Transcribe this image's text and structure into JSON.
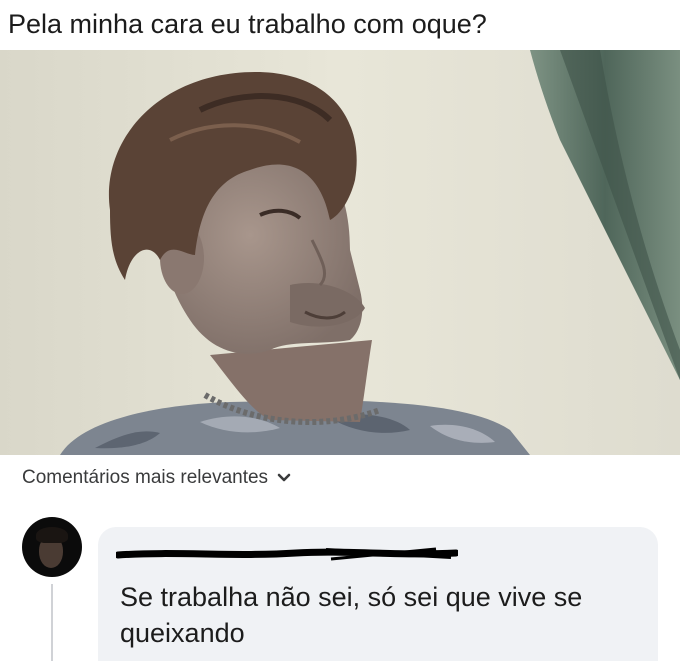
{
  "post": {
    "text": "Pela minha cara eu trabalho com oque?"
  },
  "photo": {
    "icon": "selfie-photo"
  },
  "comments": {
    "filter_label": "Comentários mais relevantes",
    "filter_icon": "chevron-down-icon",
    "items": [
      {
        "author": "",
        "text": "Se trabalha não sei, só sei que vive se queixando"
      }
    ]
  },
  "colors": {
    "bubble_background": "#f0f2f5",
    "text": "#1c1c1c",
    "secondary_text": "#3a3b3c"
  }
}
